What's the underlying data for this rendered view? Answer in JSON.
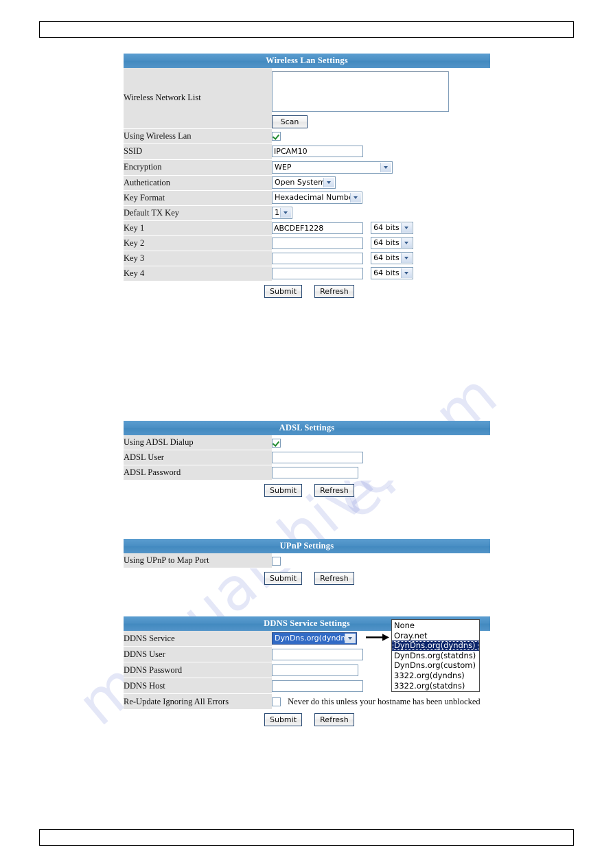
{
  "watermark": {
    "line1": "manualshive",
    "line2": "e.com"
  },
  "panels": {
    "wireless": {
      "title": "Wireless Lan Settings",
      "rows": {
        "network_list_label": "Wireless Network List",
        "scan_button": "Scan",
        "using_wireless_lan_label": "Using Wireless Lan",
        "using_wireless_lan_checked": true,
        "ssid_label": "SSID",
        "ssid_value": "IPCAM10",
        "encryption_label": "Encryption",
        "encryption_value": "WEP",
        "authetication_label": "Authetication",
        "authetication_value": "Open System",
        "key_format_label": "Key Format",
        "key_format_value": "Hexadecimal Number",
        "default_tx_key_label": "Default TX Key",
        "default_tx_key_value": "1",
        "key1_label": "Key 1",
        "key1_value": "ABCDEF1228",
        "key1_bits": "64 bits",
        "key2_label": "Key 2",
        "key2_value": "",
        "key2_bits": "64 bits",
        "key3_label": "Key 3",
        "key3_value": "",
        "key3_bits": "64 bits",
        "key4_label": "Key 4",
        "key4_value": "",
        "key4_bits": "64 bits"
      },
      "submit_button": "Submit",
      "refresh_button": "Refresh"
    },
    "adsl": {
      "title": "ADSL Settings",
      "rows": {
        "using_adsl_dialup_label": "Using ADSL Dialup",
        "using_adsl_dialup_checked": true,
        "adsl_user_label": "ADSL User",
        "adsl_user_value": "",
        "adsl_password_label": "ADSL Password",
        "adsl_password_value": ""
      },
      "submit_button": "Submit",
      "refresh_button": "Refresh"
    },
    "upnp": {
      "title": "UPnP Settings",
      "rows": {
        "using_upnp_label": "Using UPnP to Map Port",
        "using_upnp_checked": false
      },
      "submit_button": "Submit",
      "refresh_button": "Refresh"
    },
    "ddns": {
      "title": "DDNS Service Settings",
      "rows": {
        "ddns_service_label": "DDNS Service",
        "ddns_service_value": "DynDns.org(dyndns)",
        "ddns_user_label": "DDNS User",
        "ddns_user_value": "",
        "ddns_password_label": "DDNS Password",
        "ddns_password_value": "",
        "ddns_host_label": "DDNS Host",
        "ddns_host_value": "",
        "reupdate_label": "Re-Update Ignoring All Errors",
        "reupdate_checked": false,
        "reupdate_note": "Never do this unless your hostname has been unblocked"
      },
      "submit_button": "Submit",
      "refresh_button": "Refresh",
      "dropdown_options": [
        "None",
        "Oray.net",
        "DynDns.org(dyndns)",
        "DynDns.org(statdns)",
        "DynDns.org(custom)",
        "3322.org(dyndns)",
        "3322.org(statdns)"
      ],
      "dropdown_selected_index": 2
    }
  },
  "colors": {
    "panel_title_bg": "#4a8fc4",
    "label_bg": "#e2e2e2",
    "select_highlight": "#0a246a",
    "checkbox_check": "#1f8a2d"
  }
}
